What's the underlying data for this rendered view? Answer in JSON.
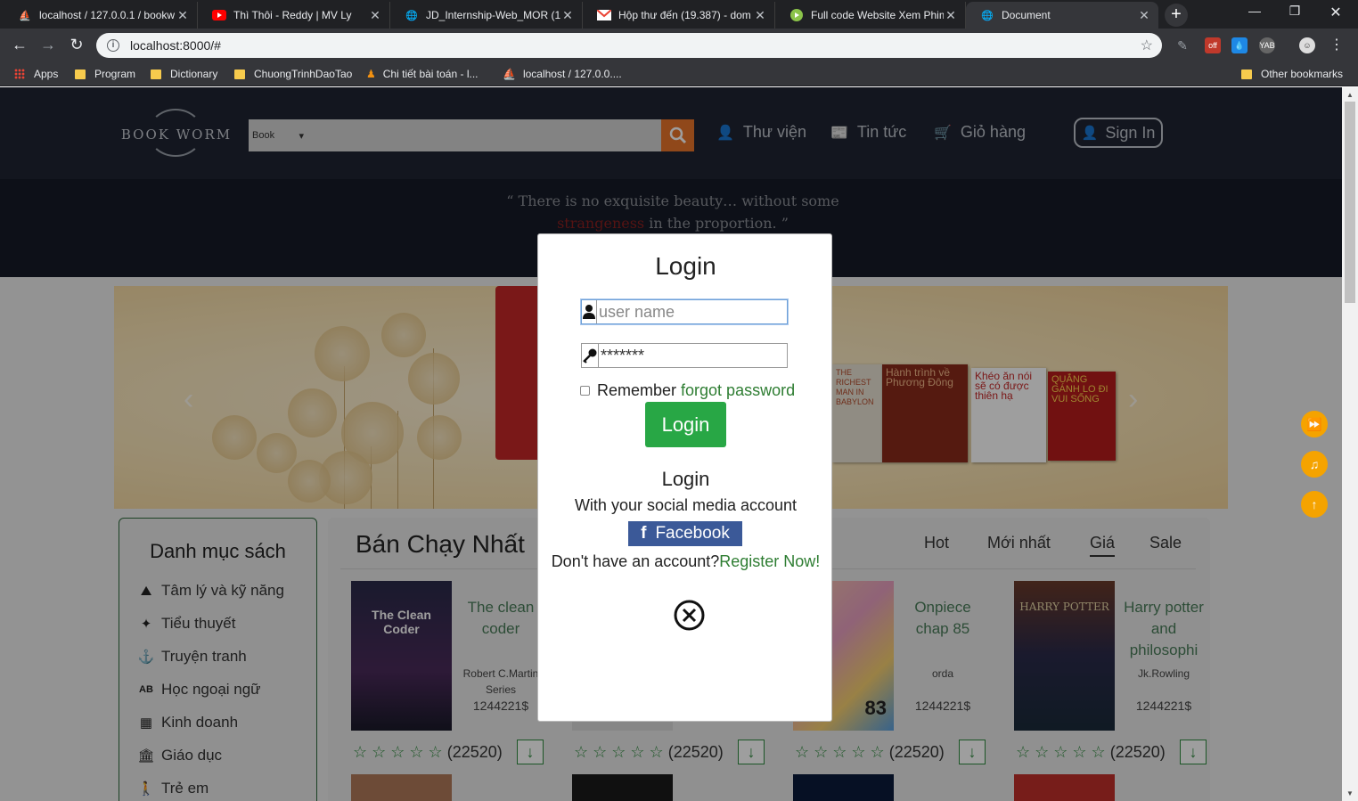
{
  "browser": {
    "tabs": [
      {
        "title": "localhost / 127.0.0.1 / bookw",
        "favicon": "phpmyadmin-icon"
      },
      {
        "title": "Thì Thôi - Reddy | MV Ly",
        "favicon": "youtube-icon"
      },
      {
        "title": "JD_Internship-Web_MOR (1)",
        "favicon": "globe-icon"
      },
      {
        "title": "Hộp thư đến (19.387) - dom",
        "favicon": "gmail-icon"
      },
      {
        "title": "Full code Website Xem Phim",
        "favicon": "site-icon"
      },
      {
        "title": "Document",
        "favicon": "globe-icon"
      }
    ],
    "url": "localhost:8000/#",
    "bookmarks": [
      "Apps",
      "Program",
      "Dictionary",
      "ChuongTrinhDaoTao",
      "Chi tiết bài toán - l...",
      "localhost / 127.0.0....",
      "Other bookmarks"
    ]
  },
  "site": {
    "logo": "BOOK WORM",
    "search_category": "Book",
    "nav": {
      "library": "Thư viện",
      "news": "Tin tức",
      "cart": "Giỏ hàng",
      "signin": "Sign In"
    },
    "quote": {
      "part1": "“ There is no exquisite beauty… without some ",
      "highlight": "strangeness",
      "part2": " in the proportion. ”"
    },
    "categories_title": "Danh mục sách",
    "categories": [
      "Tâm lý và kỹ năng",
      "Tiểu thuyết",
      "Truyện tranh",
      "Học ngoại ngữ",
      "Kinh doanh",
      "Giáo dục",
      "Trẻ em"
    ],
    "section_title": "Bán Chạy Nhất",
    "filters": [
      "Hot",
      "Mới nhất",
      "Giá",
      "Sale"
    ],
    "active_filter": "Giá",
    "products": [
      {
        "name": "The clean coder",
        "author": "Robert C.Martin Series",
        "price": "1244221$",
        "rating_count": "(22520)",
        "cover_text": "The Clean Coder"
      },
      {
        "name": "",
        "author": "",
        "price": "",
        "rating_count": "(22520)",
        "cover_text": ""
      },
      {
        "name": "Onpiece chap 85",
        "author": "orda",
        "price": "1244221$",
        "rating_count": "(22520)",
        "cover_text": "83"
      },
      {
        "name": "Harry potter and philosophi",
        "author": "Jk.Rowling",
        "price": "1244221$",
        "rating_count": "(22520)",
        "cover_text": "HARRY POTTER"
      }
    ],
    "banner_books": [
      "THE RICHEST MAN IN BABYLON",
      "Hành trình về Phương Đông",
      "Khéo ăn nói sẽ có được thiên hạ",
      "QUẲNG GÁNH LO ĐI VUI SỐNG"
    ]
  },
  "modal": {
    "title": "Login",
    "username_placeholder": "user name",
    "password_value": "*******",
    "remember_label": "Remember",
    "forgot_label": "forgot password",
    "login_button": "Login",
    "social_title": "Login",
    "social_subtitle": "With your social media account",
    "facebook_button": "Facebook",
    "register_prompt": "Don't have an account?",
    "register_link": "Register Now!"
  },
  "colors": {
    "accent_green": "#28a745",
    "header_bg": "#1f2533",
    "facebook": "#3b5998",
    "search_button": "#e8742a"
  }
}
